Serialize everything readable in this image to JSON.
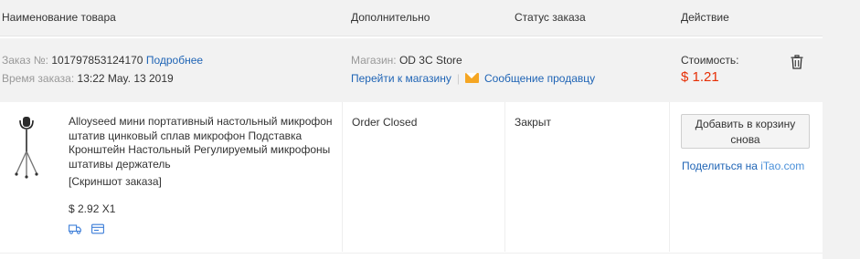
{
  "table_header": {
    "product": "Наименование товара",
    "additional": "Дополнительно",
    "status": "Статус заказа",
    "action": "Действие"
  },
  "order": {
    "number_label": "Заказ №:",
    "number": "101797853124170",
    "details_link": "Подробнее",
    "time_label": "Время заказа:",
    "time": "13:22 May. 13 2019",
    "store_label": "Магазин:",
    "store_name": "OD 3C Store",
    "store_link": "Перейти к магазину",
    "separator": "|",
    "message_link": "Сообщение продавцу",
    "cost_label": "Стоимость:",
    "cost": "$ 1.21",
    "icons": {
      "message": "envelope-icon",
      "delete": "trash-icon"
    }
  },
  "item": {
    "title": "Alloyseed мини портативный настольный микрофон штатив цинковый сплав микрофон Подставка Кронштейн Настольный Регулируемый микрофоны штативы держатель",
    "snapshot_link": "[Скриншот заказа]",
    "unit_price": "$ 2.92 X1",
    "icons": [
      "shipping-truck-icon",
      "card-icon"
    ],
    "additional_status": "Order Closed",
    "order_status": "Закрыт",
    "reorder_button": "Добавить в корзину снова",
    "share_prefix": "Поделиться на ",
    "share_site": "iTao.com"
  },
  "colors": {
    "link": "#1f64b5",
    "price": "#e62e04",
    "header_bg": "#f2f2f2",
    "envelope": "#f5a623"
  }
}
